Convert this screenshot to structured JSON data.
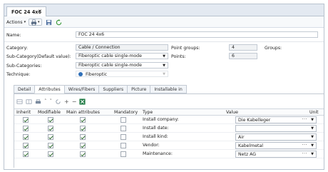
{
  "tab": {
    "title": "FOC 24 4x6",
    "close": "✕"
  },
  "toolbar": {
    "actions_label": "Actions",
    "actions_arrow": "▾",
    "print_arrow": "▾"
  },
  "form": {
    "name_label": "Name:",
    "name_value": "FOC 24 4x6",
    "category_label": "Category:",
    "category_value": "Cable / Connection",
    "subcat_default_label": "Sub-Category(Default value):",
    "subcat_default_value": "Fiberoptic cable single-mode",
    "subcats_label": "Sub-Categories:",
    "subcats_value": "Fiberoptic cable single-mode",
    "technique_label": "Technique:",
    "technique_value": "Fiberoptic",
    "point_groups_label": "Point groups:",
    "point_groups_value": "4",
    "groups_label": "Groups:",
    "points_label": "Points:",
    "points_value": "6"
  },
  "subtabs": [
    "Detail",
    "Attributes",
    "Wires/Fibers",
    "Suppliers",
    "Picture",
    "Installable in"
  ],
  "grid": {
    "headers": [
      "Inherit",
      "Modifiable",
      "Main attributes",
      "Mandatory",
      "Type",
      "Value",
      "Unit"
    ],
    "rows": [
      {
        "inherit": true,
        "modifiable": true,
        "main": true,
        "mandatory": false,
        "type": "Install company:",
        "value": "Die Kabelleger",
        "dots": true
      },
      {
        "inherit": true,
        "modifiable": true,
        "main": true,
        "mandatory": false,
        "type": "Install date:",
        "value": "",
        "dots": false
      },
      {
        "inherit": true,
        "modifiable": true,
        "main": true,
        "mandatory": false,
        "type": "Install kind:",
        "value": "Air",
        "dots": false
      },
      {
        "inherit": true,
        "modifiable": true,
        "main": true,
        "mandatory": false,
        "type": "Vendor:",
        "value": "Kabelmetal",
        "dots": true
      },
      {
        "inherit": true,
        "modifiable": true,
        "main": true,
        "mandatory": false,
        "type": "Maintenance:",
        "value": "Netz AG",
        "dots": true
      }
    ]
  },
  "colors": {
    "accent": "#2f6fb8",
    "border": "#b9c3cf",
    "check": "#2b6b2b"
  },
  "icons": [
    "print-icon",
    "save-icon",
    "refresh-icon",
    "info-icon",
    "add-icon",
    "remove-icon",
    "move-up-icon",
    "move-down-icon",
    "excel-icon"
  ]
}
